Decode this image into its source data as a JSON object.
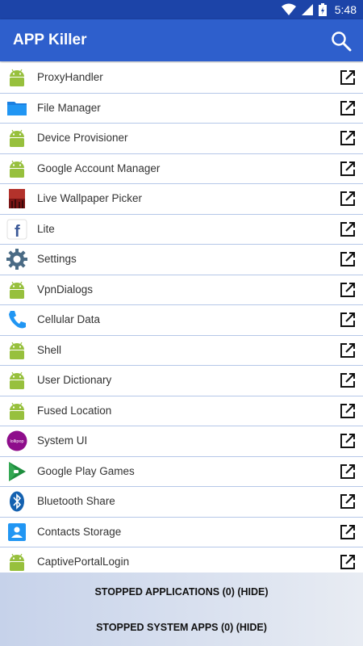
{
  "status_bar": {
    "time": "5:48"
  },
  "app_bar": {
    "title": "APP Killer",
    "search_icon": "search-icon"
  },
  "apps": [
    {
      "name": "ProxyHandler",
      "icon": "android"
    },
    {
      "name": "File Manager",
      "icon": "folder"
    },
    {
      "name": "Device Provisioner",
      "icon": "android"
    },
    {
      "name": "Google Account Manager",
      "icon": "android"
    },
    {
      "name": "Live Wallpaper Picker",
      "icon": "wallpaper"
    },
    {
      "name": "Lite",
      "icon": "facebook"
    },
    {
      "name": "Settings",
      "icon": "gear"
    },
    {
      "name": "VpnDialogs",
      "icon": "android"
    },
    {
      "name": "Cellular Data",
      "icon": "phone"
    },
    {
      "name": "Shell",
      "icon": "android"
    },
    {
      "name": "User Dictionary",
      "icon": "android"
    },
    {
      "name": "Fused Location",
      "icon": "android"
    },
    {
      "name": "System UI",
      "icon": "lollipop",
      "icon_text": "lollipop"
    },
    {
      "name": "Google Play Games",
      "icon": "play-games"
    },
    {
      "name": "Bluetooth Share",
      "icon": "bluetooth"
    },
    {
      "name": "Contacts Storage",
      "icon": "contacts"
    },
    {
      "name": "CaptivePortalLogin",
      "icon": "android"
    }
  ],
  "footer": {
    "stopped_apps": "STOPPED APPLICATIONS (0) (HIDE)",
    "stopped_system_apps": "STOPPED SYSTEM APPS (0) (HIDE)"
  },
  "colors": {
    "status_bar": "#1c44a8",
    "app_bar": "#2e5fcc",
    "divider": "#b5c7e8",
    "android_green": "#97c03d"
  }
}
